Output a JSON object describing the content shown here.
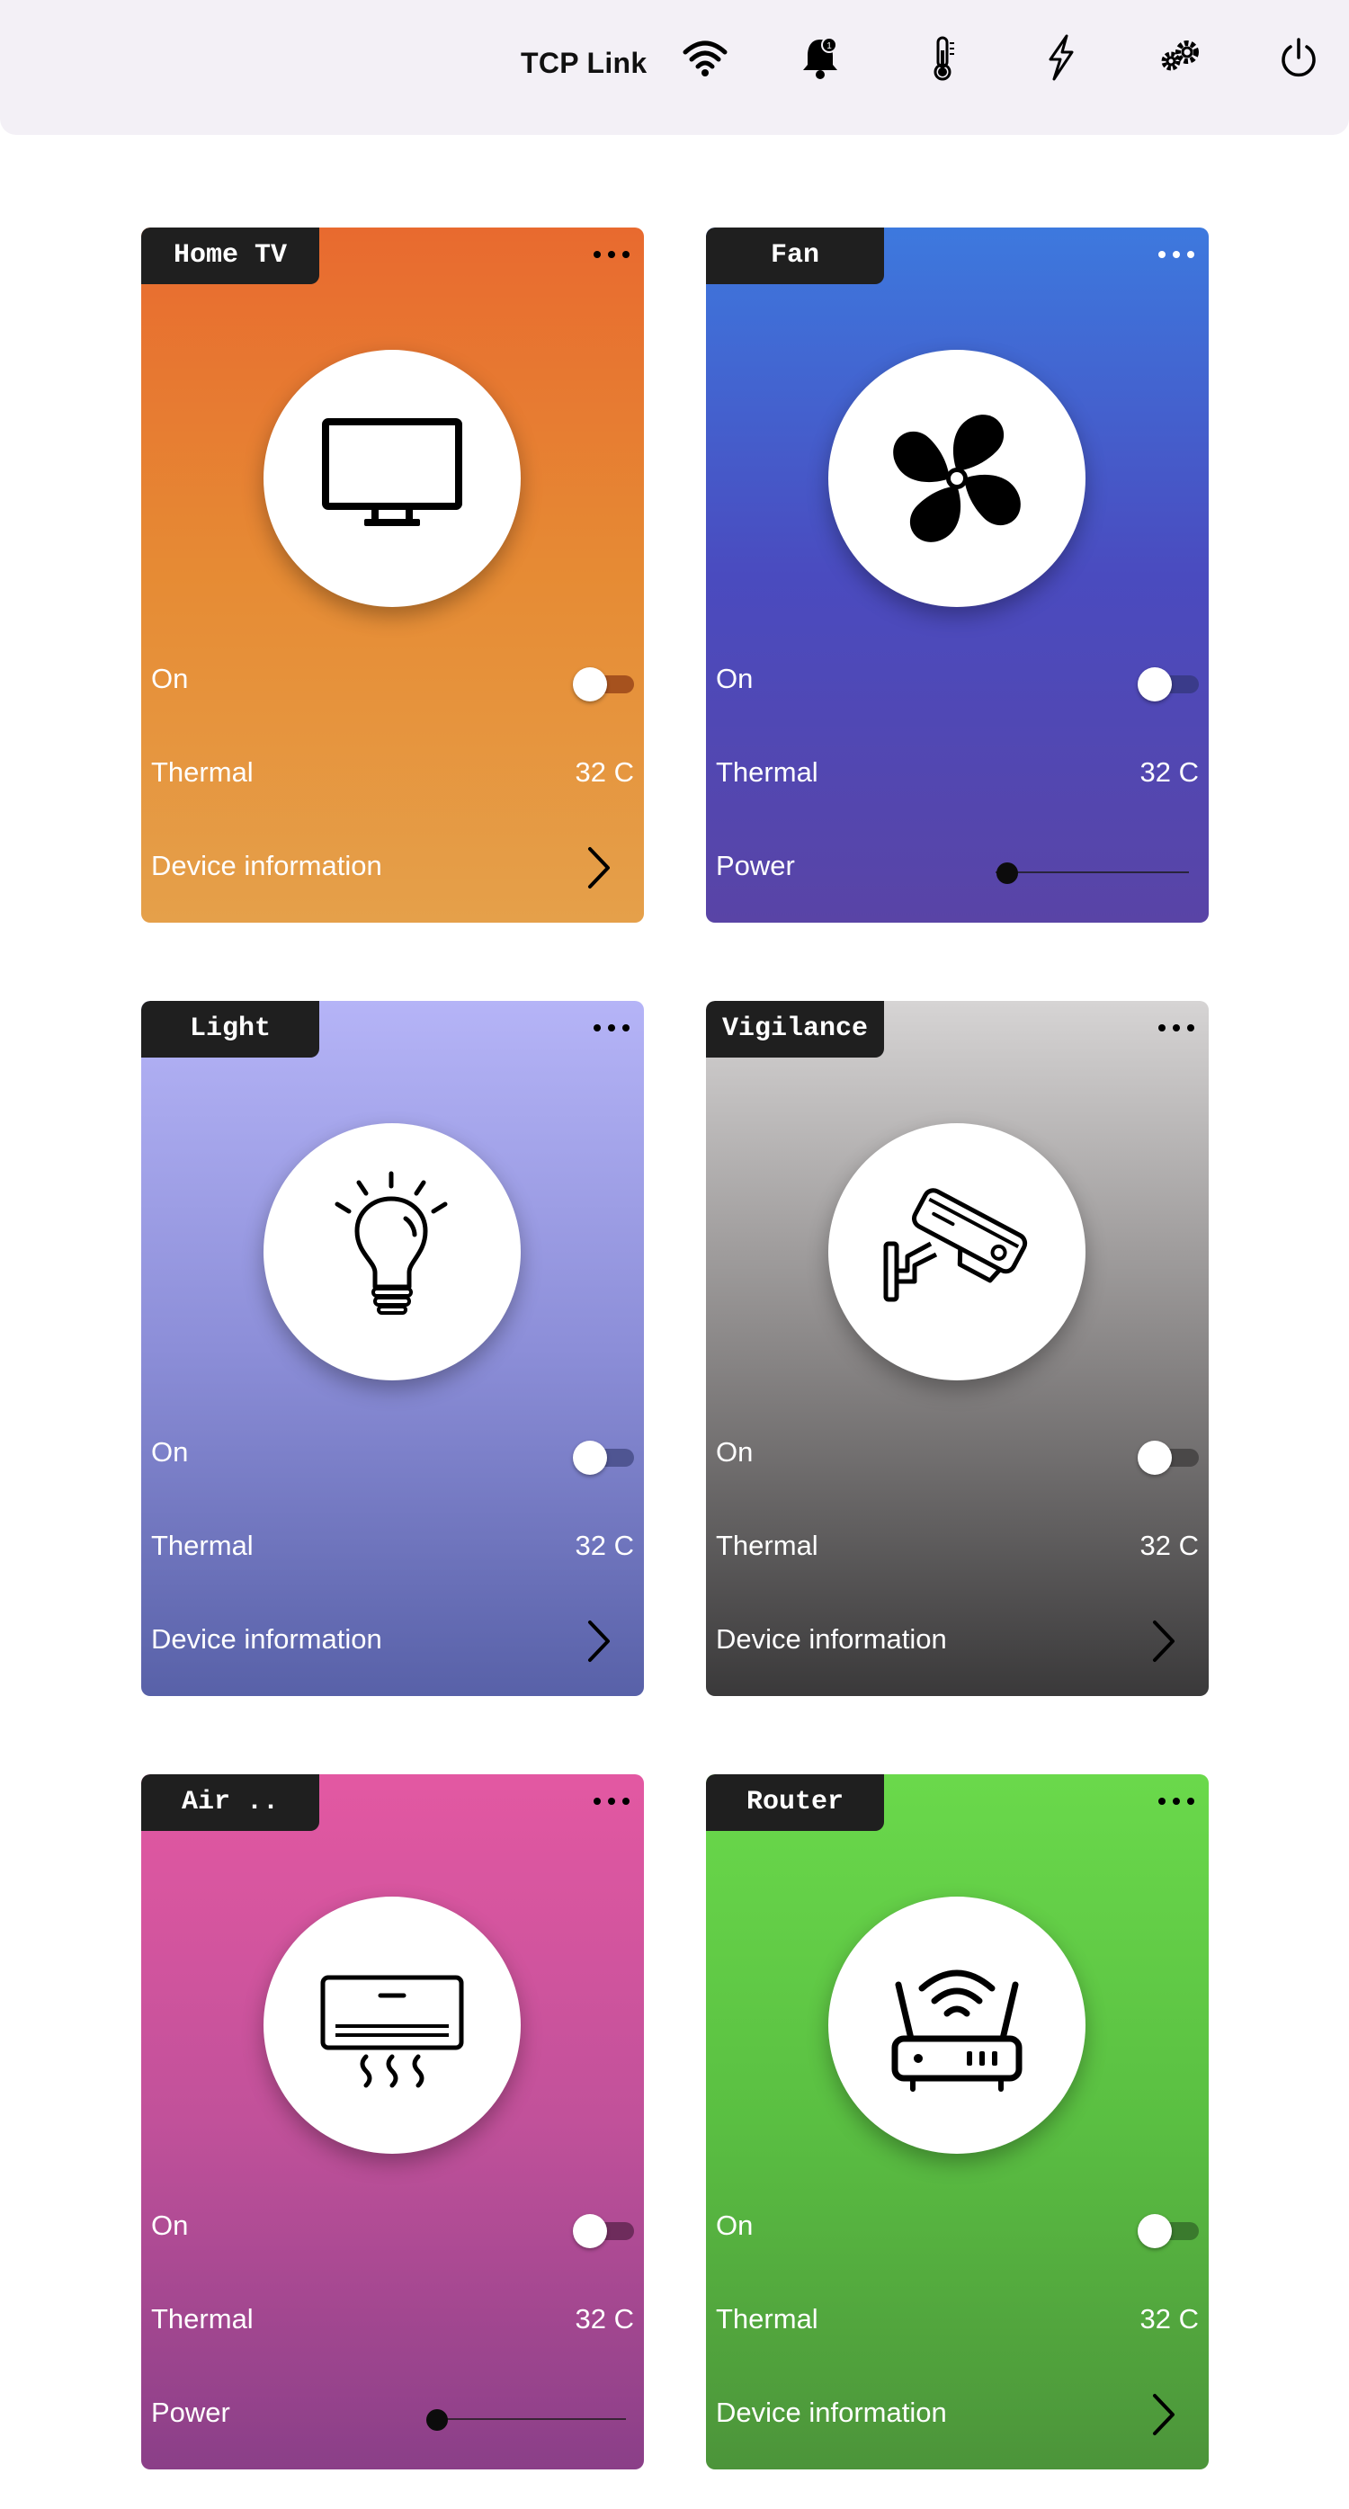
{
  "header": {
    "title": "TCP Link",
    "icons": [
      "wifi-icon",
      "bell-icon",
      "thermometer-icon",
      "lightning-icon",
      "gears-icon",
      "power-icon"
    ],
    "notification_count": "1"
  },
  "cards": [
    {
      "name": "Home TV",
      "icon": "tv-icon",
      "accent": "#e86a2f",
      "state_label": "On",
      "toggle_track": "#a6521e",
      "thermal_label": "Thermal",
      "thermal_value": "32 C",
      "bottom_label": "Device information",
      "bottom_type": "link"
    },
    {
      "name": "Fan",
      "icon": "fan-icon",
      "accent": "#3d79de",
      "state_label": "On",
      "toggle_track": "#3a3b8a",
      "thermal_label": "Thermal",
      "thermal_value": "32 C",
      "bottom_label": "Power",
      "bottom_type": "slider",
      "power_level": 0.06
    },
    {
      "name": "Light",
      "icon": "lightbulb-icon",
      "accent": "#b5b4f7",
      "state_label": "On",
      "toggle_track": "#4f5592",
      "thermal_label": "Thermal",
      "thermal_value": "32 C",
      "bottom_label": "Device information",
      "bottom_type": "link"
    },
    {
      "name": "Vigilance",
      "icon": "security-camera-icon",
      "accent": "#8a8787",
      "state_label": "On",
      "toggle_track": "#4a4848",
      "thermal_label": "Thermal",
      "thermal_value": "32 C",
      "bottom_label": "Device information",
      "bottom_type": "link"
    },
    {
      "name": "Air ..",
      "icon": "air-conditioner-icon",
      "accent": "#e358a2",
      "state_label": "On",
      "toggle_track": "#6e2c5c",
      "thermal_label": "Thermal",
      "thermal_value": "32 C",
      "bottom_label": "Power",
      "bottom_type": "slider",
      "power_level": 0.04
    },
    {
      "name": "Router",
      "icon": "router-icon",
      "accent": "#6ad94b",
      "state_label": "On",
      "toggle_track": "#3a7a2d",
      "thermal_label": "Thermal",
      "thermal_value": "32 C",
      "bottom_label": "Device information",
      "bottom_type": "link"
    }
  ]
}
